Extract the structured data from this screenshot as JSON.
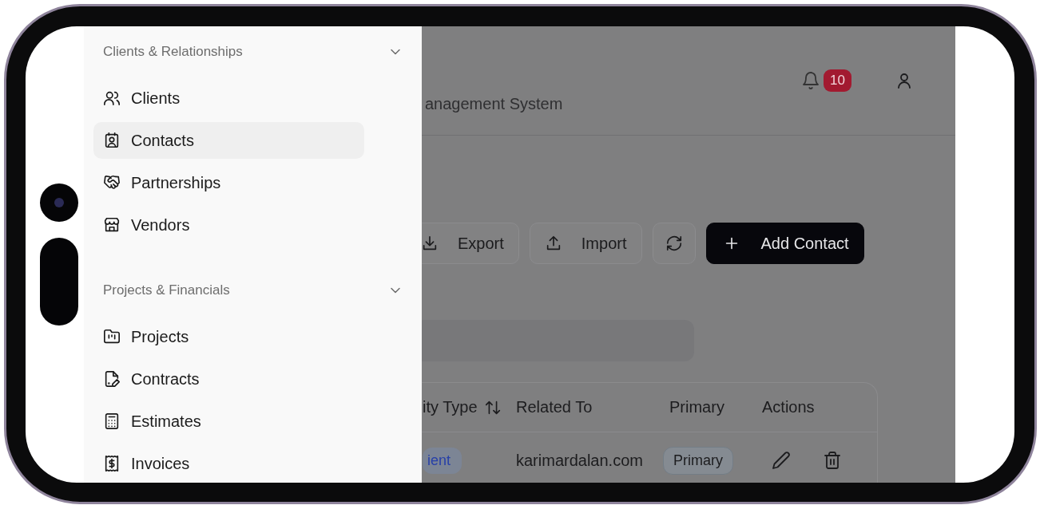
{
  "sidebar": {
    "groups": [
      {
        "title": "Clients & Relationships",
        "expanded": true,
        "items": [
          {
            "label": "Clients",
            "selected": false
          },
          {
            "label": "Contacts",
            "selected": true
          },
          {
            "label": "Partnerships",
            "selected": false
          },
          {
            "label": "Vendors",
            "selected": false
          }
        ]
      },
      {
        "title": "Projects & Financials",
        "expanded": true,
        "items": [
          {
            "label": "Projects",
            "selected": false
          },
          {
            "label": "Contracts",
            "selected": false
          },
          {
            "label": "Estimates",
            "selected": false
          },
          {
            "label": "Invoices",
            "selected": false
          }
        ]
      }
    ]
  },
  "header": {
    "title": "anagement System",
    "notification_count": "10"
  },
  "toolbar": {
    "buttons": [
      {
        "kind": "outline",
        "label": "Export"
      },
      {
        "kind": "outline",
        "label": "Import"
      },
      {
        "kind": "icon"
      },
      {
        "kind": "primary",
        "label": "Add Contact"
      }
    ]
  },
  "table": {
    "columns": [
      {
        "label": "ity Type",
        "sortable": true
      },
      {
        "label": "Related To",
        "sortable": false
      },
      {
        "label": "Primary",
        "sortable": false
      },
      {
        "label": "Actions",
        "sortable": false
      }
    ],
    "rows": [
      {
        "cells": [
          {
            "kind": "tag",
            "text": "ient"
          },
          {
            "kind": "text",
            "text": "karimardalan.com"
          },
          {
            "kind": "badge",
            "text": "Primary"
          },
          {
            "kind": "actions"
          }
        ]
      }
    ]
  }
}
